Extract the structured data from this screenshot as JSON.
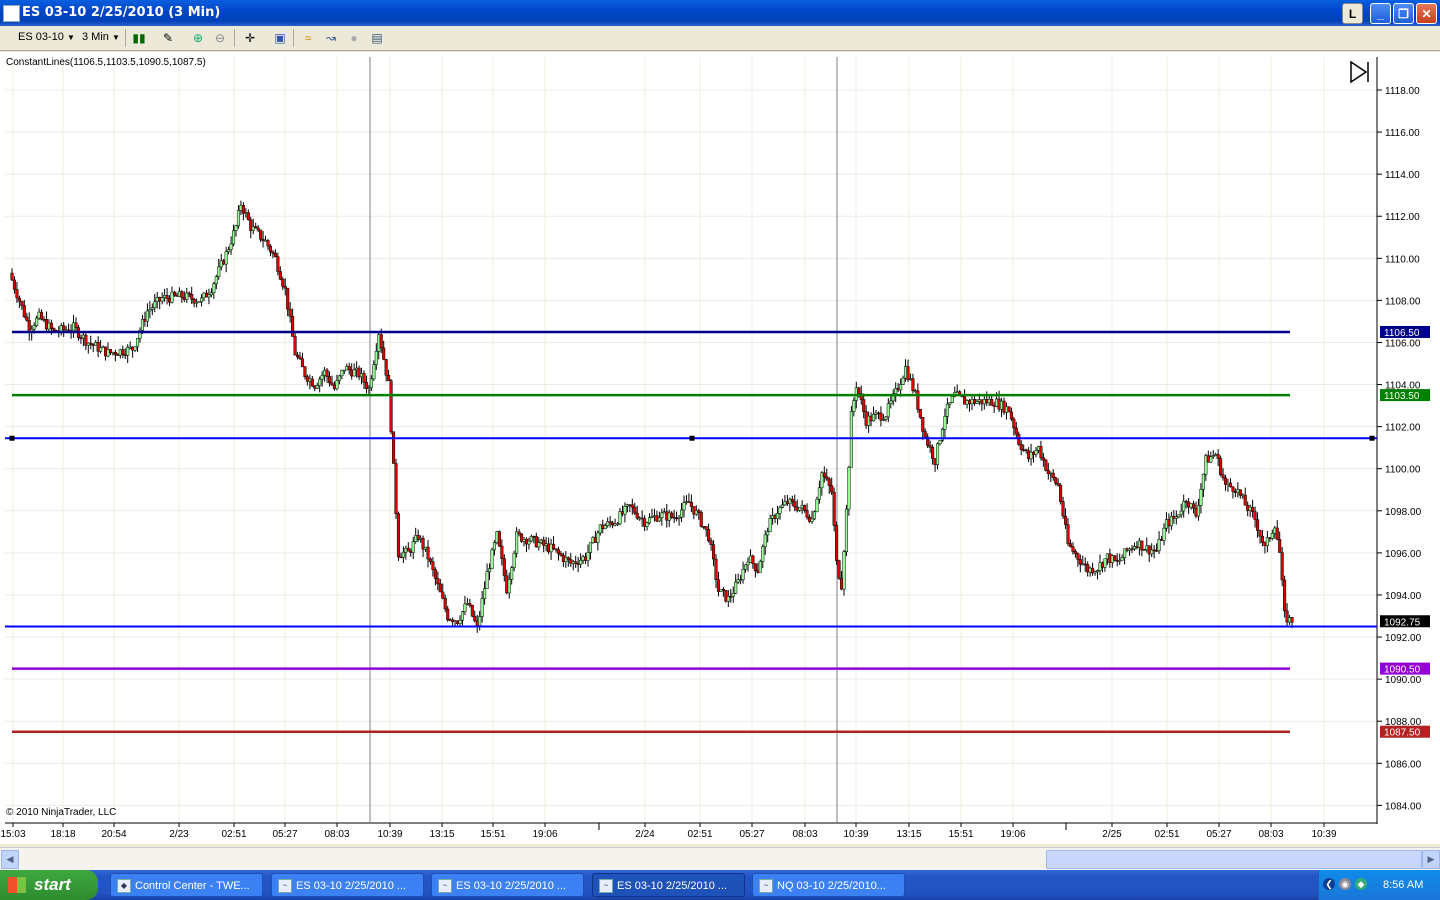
{
  "window": {
    "title": "ES 03-10  2/25/2010 (3 Min)",
    "caption_buttons": [
      "L",
      "_",
      "❐",
      "✕"
    ]
  },
  "toolbar": {
    "instrument": "ES 03-10",
    "interval": "3 Min",
    "icons": [
      "candlestick-style-icon",
      "draw-pencil-icon",
      "zoom-in-icon",
      "zoom-out-icon",
      "crosshair-icon",
      "chart-properties-icon",
      "indicators-icon",
      "strategies-icon",
      "circle-icon",
      "data-box-icon"
    ]
  },
  "chart": {
    "indicator_label": "ConstantLines(1106.5,1103.5,1090.5,1087.5)",
    "copyright": "© 2010 NinjaTrader, LLC",
    "y_ticks": [
      "1118.00",
      "1116.00",
      "1114.00",
      "1112.00",
      "1110.00",
      "1108.00",
      "1106.00",
      "1104.00",
      "1102.00",
      "1100.00",
      "1098.00",
      "1096.00",
      "1094.00",
      "1092.00",
      "1090.00",
      "1088.00",
      "1086.00",
      "1084.00"
    ],
    "x_ticks": [
      "15:03",
      "18:18",
      "20:54",
      "2/23",
      "02:51",
      "05:27",
      "08:03",
      "10:39",
      "13:15",
      "15:51",
      "19:06",
      "2/24",
      "02:51",
      "05:27",
      "08:03",
      "10:39",
      "13:15",
      "15:51",
      "19:06",
      "2/25",
      "02:51",
      "05:27",
      "08:03",
      "10:39"
    ],
    "constant_lines": [
      {
        "label": "1106.50",
        "value": 1106.5,
        "color": "#00008b"
      },
      {
        "label": "1103.50",
        "value": 1103.5,
        "color": "#008000"
      },
      {
        "label": "1090.50",
        "value": 1090.5,
        "color": "#9400d3"
      },
      {
        "label": "1087.50",
        "value": 1087.5,
        "color": "#b22222"
      }
    ],
    "drawn_lines": [
      {
        "value": 1101.45,
        "color": "#0000ff"
      },
      {
        "value": 1092.5,
        "color": "#0000ff"
      }
    ],
    "last_price": {
      "label": "1092.75",
      "value": 1092.75
    },
    "colors": {
      "up": "#98fb98",
      "down": "#dc0000",
      "wick": "#000000"
    }
  },
  "taskbar": {
    "start_label": "start",
    "tasks": [
      {
        "label": "Control Center - TWE...",
        "active": false
      },
      {
        "label": "ES 03-10  2/25/2010 ...",
        "active": false
      },
      {
        "label": "ES 03-10  2/25/2010 ...",
        "active": false
      },
      {
        "label": "ES 03-10  2/25/2010 ...",
        "active": true
      },
      {
        "label": "NQ 03-10  2/25/2010..."
      }
    ],
    "clock": "8:56 AM"
  }
}
